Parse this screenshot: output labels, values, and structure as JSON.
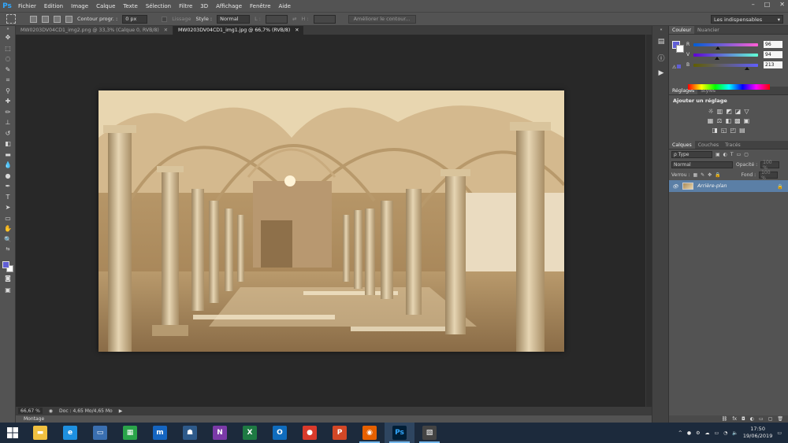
{
  "menubar": {
    "logo": "Ps",
    "items": [
      "Fichier",
      "Edition",
      "Image",
      "Calque",
      "Texte",
      "Sélection",
      "Filtre",
      "3D",
      "Affichage",
      "Fenêtre",
      "Aide"
    ],
    "window_controls": [
      "–",
      "□",
      "✕"
    ]
  },
  "options": {
    "feather_label": "Contour progr. :",
    "feather_value": "0 px",
    "smooth_label": "Lissage",
    "style_label": "Style :",
    "style_value": "Normal",
    "width_label": "L :",
    "height_label": "H :",
    "refine_button": "Améliorer le contour...",
    "workspace": "Les indispensables"
  },
  "tabs": [
    {
      "label": "MW0203DV04CD1_img2.png @ 33,3% (Calque 0, RVB/8)",
      "close": "✕",
      "active": false
    },
    {
      "label": "MW0203DV04CD1_img1.jpg @ 66,7% (RVB/8)",
      "close": "✕",
      "active": true
    }
  ],
  "status": {
    "zoom": "66,67 %",
    "doc": "Doc : 4,65 Mo/4,65 Mo",
    "arrow": "▶",
    "minibridge": "Montage"
  },
  "color_panel": {
    "tabs": [
      "Couleur",
      "Nuancier"
    ],
    "channels": [
      {
        "letter": "R",
        "value": "96",
        "fraction": 0.376,
        "gradient": "linear-gradient(to right, #005ed5, #ff5ed5)"
      },
      {
        "letter": "V",
        "value": "94",
        "fraction": 0.369,
        "gradient": "linear-gradient(to right, #6000d5, #60ffd5)"
      },
      {
        "letter": "B",
        "value": "213",
        "fraction": 0.835,
        "gradient": "linear-gradient(to right, #605e00, #605eff)"
      }
    ],
    "foreground": "#605ed5"
  },
  "adjustments": {
    "tabs": [
      "Réglages",
      "Styles"
    ],
    "heading": "Ajouter un réglage",
    "rows": [
      [
        "☼",
        "▥",
        "◩",
        "◪",
        "▽"
      ],
      [
        "▦",
        "⚖",
        "◧",
        "▩",
        "▣"
      ],
      [
        "◨",
        "◱",
        "◰",
        "▤"
      ]
    ]
  },
  "layers": {
    "tabs": [
      "Calques",
      "Couches",
      "Tracés"
    ],
    "filter_label": "ρ Type",
    "mode": "Normal",
    "opacity_label": "Opacité :",
    "opacity_value": "100 %",
    "lock_label": "Verrou :",
    "fill_label": "Fond :",
    "fill_value": "100 %",
    "layer_name": "Arrière-plan",
    "footer_icons": [
      "⛓",
      "fx",
      "◘",
      "◐",
      "▭",
      "▢",
      "🗑"
    ]
  },
  "taskbar": {
    "apps": [
      {
        "name": "file-explorer",
        "color": "#f0c040",
        "glyph": "▬"
      },
      {
        "name": "internet-explorer",
        "color": "#1e90e0",
        "glyph": "e"
      },
      {
        "name": "this-pc",
        "color": "#3a6fb0",
        "glyph": "▭"
      },
      {
        "name": "store",
        "color": "#2aa44a",
        "glyph": "▦"
      },
      {
        "name": "mail-app",
        "color": "#1565c0",
        "glyph": "m"
      },
      {
        "name": "defender",
        "color": "#2e5a8a",
        "glyph": "☗"
      },
      {
        "name": "onenote",
        "color": "#7b3aa8",
        "glyph": "N"
      },
      {
        "name": "excel",
        "color": "#1e7a43",
        "glyph": "X"
      },
      {
        "name": "outlook",
        "color": "#0f6cbd",
        "glyph": "O"
      },
      {
        "name": "chrome",
        "color": "#d93a2b",
        "glyph": "●"
      },
      {
        "name": "powerpoint",
        "color": "#d24726",
        "glyph": "P"
      },
      {
        "name": "firefox",
        "color": "#e66000",
        "glyph": "◉"
      },
      {
        "name": "photoshop",
        "color": "#001e36",
        "glyph": "Ps"
      },
      {
        "name": "photo-viewer",
        "color": "#444",
        "glyph": "▧"
      }
    ],
    "time": "17:50",
    "date": "19/06/2019"
  }
}
